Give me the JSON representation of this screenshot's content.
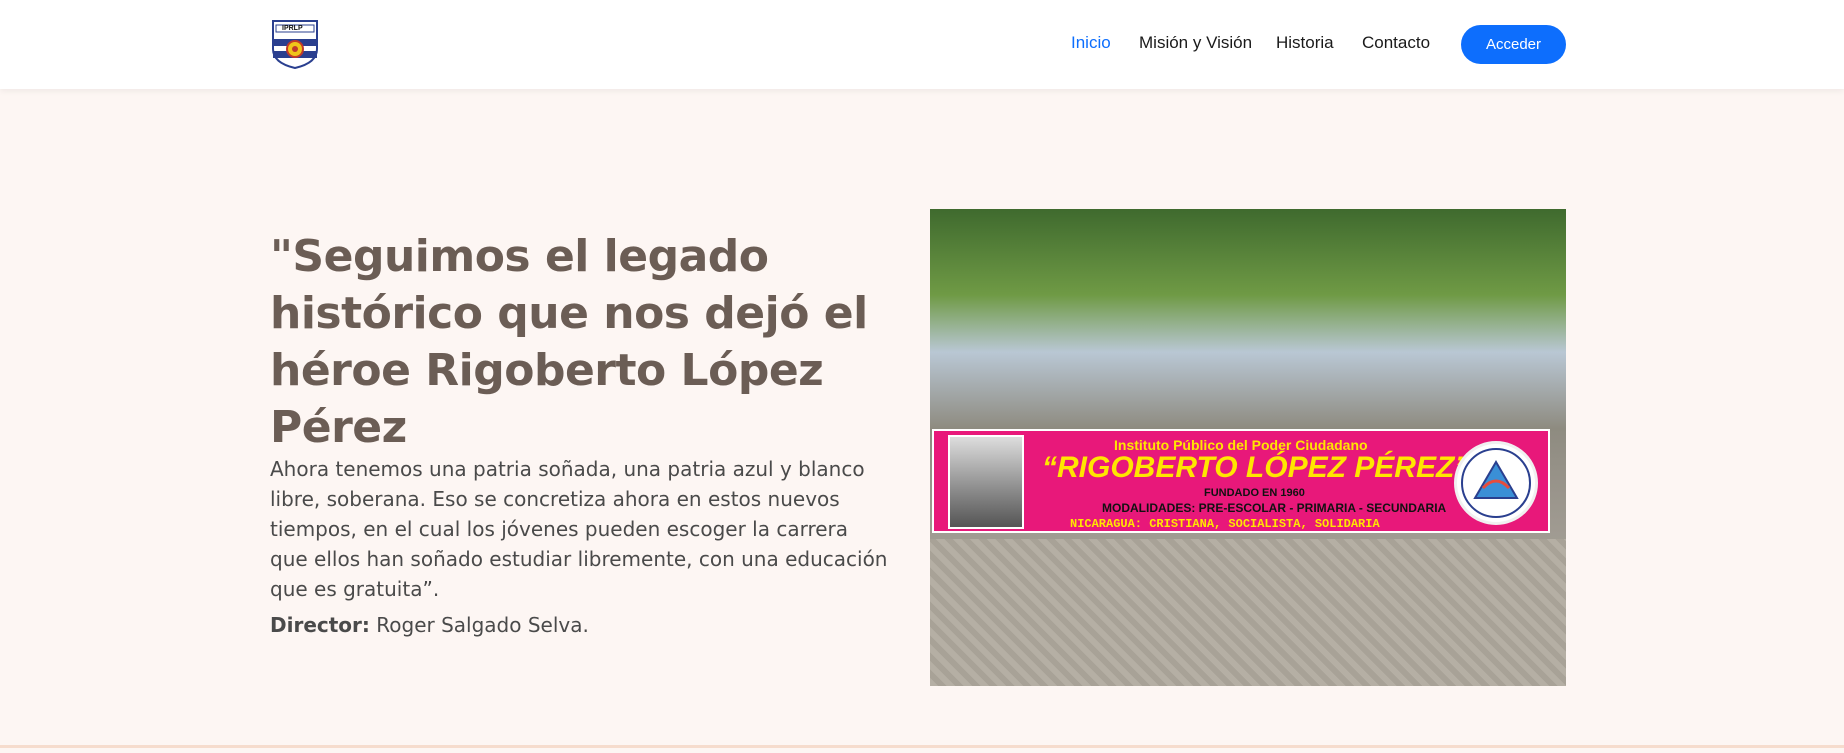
{
  "header": {
    "logo_text": "IPRLP",
    "nav": [
      {
        "label": "Inicio",
        "active": true
      },
      {
        "label": "Misión y Visión",
        "active": false
      },
      {
        "label": "Historia",
        "active": false
      },
      {
        "label": "Contacto",
        "active": false
      }
    ],
    "access_button": "Acceder"
  },
  "hero": {
    "title": "\"Seguimos el legado histórico que nos dejó el héroe Rigoberto López Pérez",
    "paragraph": "Ahora tenemos una patria soñada, una patria azul y blanco libre, soberana. Eso se concretiza ahora en estos nuevos tiempos, en el cual los jóvenes pueden escoger la carrera que ellos han soñado estudiar libremente, con una educación que es gratuita”.",
    "director_label": "Director:",
    "director_name": "Roger Salgado Selva."
  },
  "image": {
    "banner_line1": "Instituto Público del Poder Ciudadano",
    "banner_line2": "“RIGOBERTO LÓPEZ PÉREZ”",
    "banner_line3": "FUNDADO EN 1960",
    "banner_line4": "MODALIDADES: PRE-ESCOLAR - PRIMARIA - SECUNDARIA",
    "banner_line5": "NICARAGUA: CRISTIANA, SOCIALISTA, SOLIDARIA"
  },
  "colors": {
    "accent": "#0d6efd",
    "title": "#6b5d55",
    "background": "#fdf6f3",
    "banner": "#e8187a"
  }
}
